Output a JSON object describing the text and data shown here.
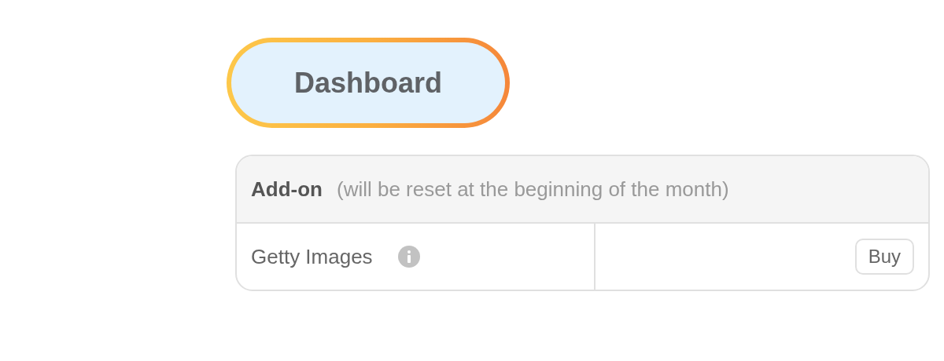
{
  "dashboard_button": {
    "label": "Dashboard"
  },
  "addon_table": {
    "title": "Add-on",
    "note": "(will be reset at the beginning of the month)",
    "rows": [
      {
        "name": "Getty Images",
        "action": "Buy"
      }
    ]
  }
}
